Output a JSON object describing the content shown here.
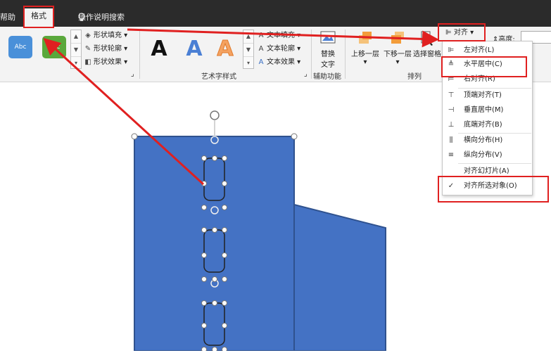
{
  "tabs": {
    "left_partial": "帮助",
    "format": "格式",
    "tell_me": "操作说明搜索"
  },
  "ribbon": {
    "shape_styles": {
      "swatch1": "Abc",
      "swatch2": "Abc",
      "fill": "形状填充",
      "outline": "形状轮廓",
      "effects": "形状效果"
    },
    "wordart": {
      "text_fill": "文本填充",
      "text_outline": "文本轮廓",
      "text_effects": "文本效果",
      "sample": "A",
      "group_label": "艺术字样式"
    },
    "accessibility": {
      "alt_text_line1": "替换",
      "alt_text_line2": "文字",
      "group_label": "辅助功能"
    },
    "arrange": {
      "bring_forward": "上移一层",
      "send_backward": "下移一层",
      "selection_pane": "选择窗格",
      "align": "对齐",
      "group_label": "排列"
    },
    "size": {
      "height_label": "高度:"
    }
  },
  "align_menu": {
    "items": [
      {
        "icon": "align-left-icon",
        "label": "左对齐(L)",
        "checked": false
      },
      {
        "icon": "align-center-icon",
        "label": "水平居中(C)",
        "checked": false
      },
      {
        "icon": "align-right-icon",
        "label": "右对齐(R)",
        "checked": false
      },
      {
        "icon": "align-top-icon",
        "label": "顶端对齐(T)",
        "checked": false
      },
      {
        "icon": "align-middle-icon",
        "label": "垂直居中(M)",
        "checked": false
      },
      {
        "icon": "align-bottom-icon",
        "label": "底端对齐(B)",
        "checked": false
      },
      {
        "icon": "distribute-horizontal-icon",
        "label": "横向分布(H)",
        "checked": false
      },
      {
        "icon": "distribute-vertical-icon",
        "label": "纵向分布(V)",
        "checked": false
      },
      {
        "icon": "",
        "label": "对齐幻灯片(A)",
        "checked": false
      },
      {
        "icon": "checkmark-icon",
        "label": "对齐所选对象(O)",
        "checked": true
      }
    ]
  },
  "colors": {
    "accent_red": "#e02020",
    "shape_blue": "#4472c4",
    "shape_border": "#2f528f"
  }
}
